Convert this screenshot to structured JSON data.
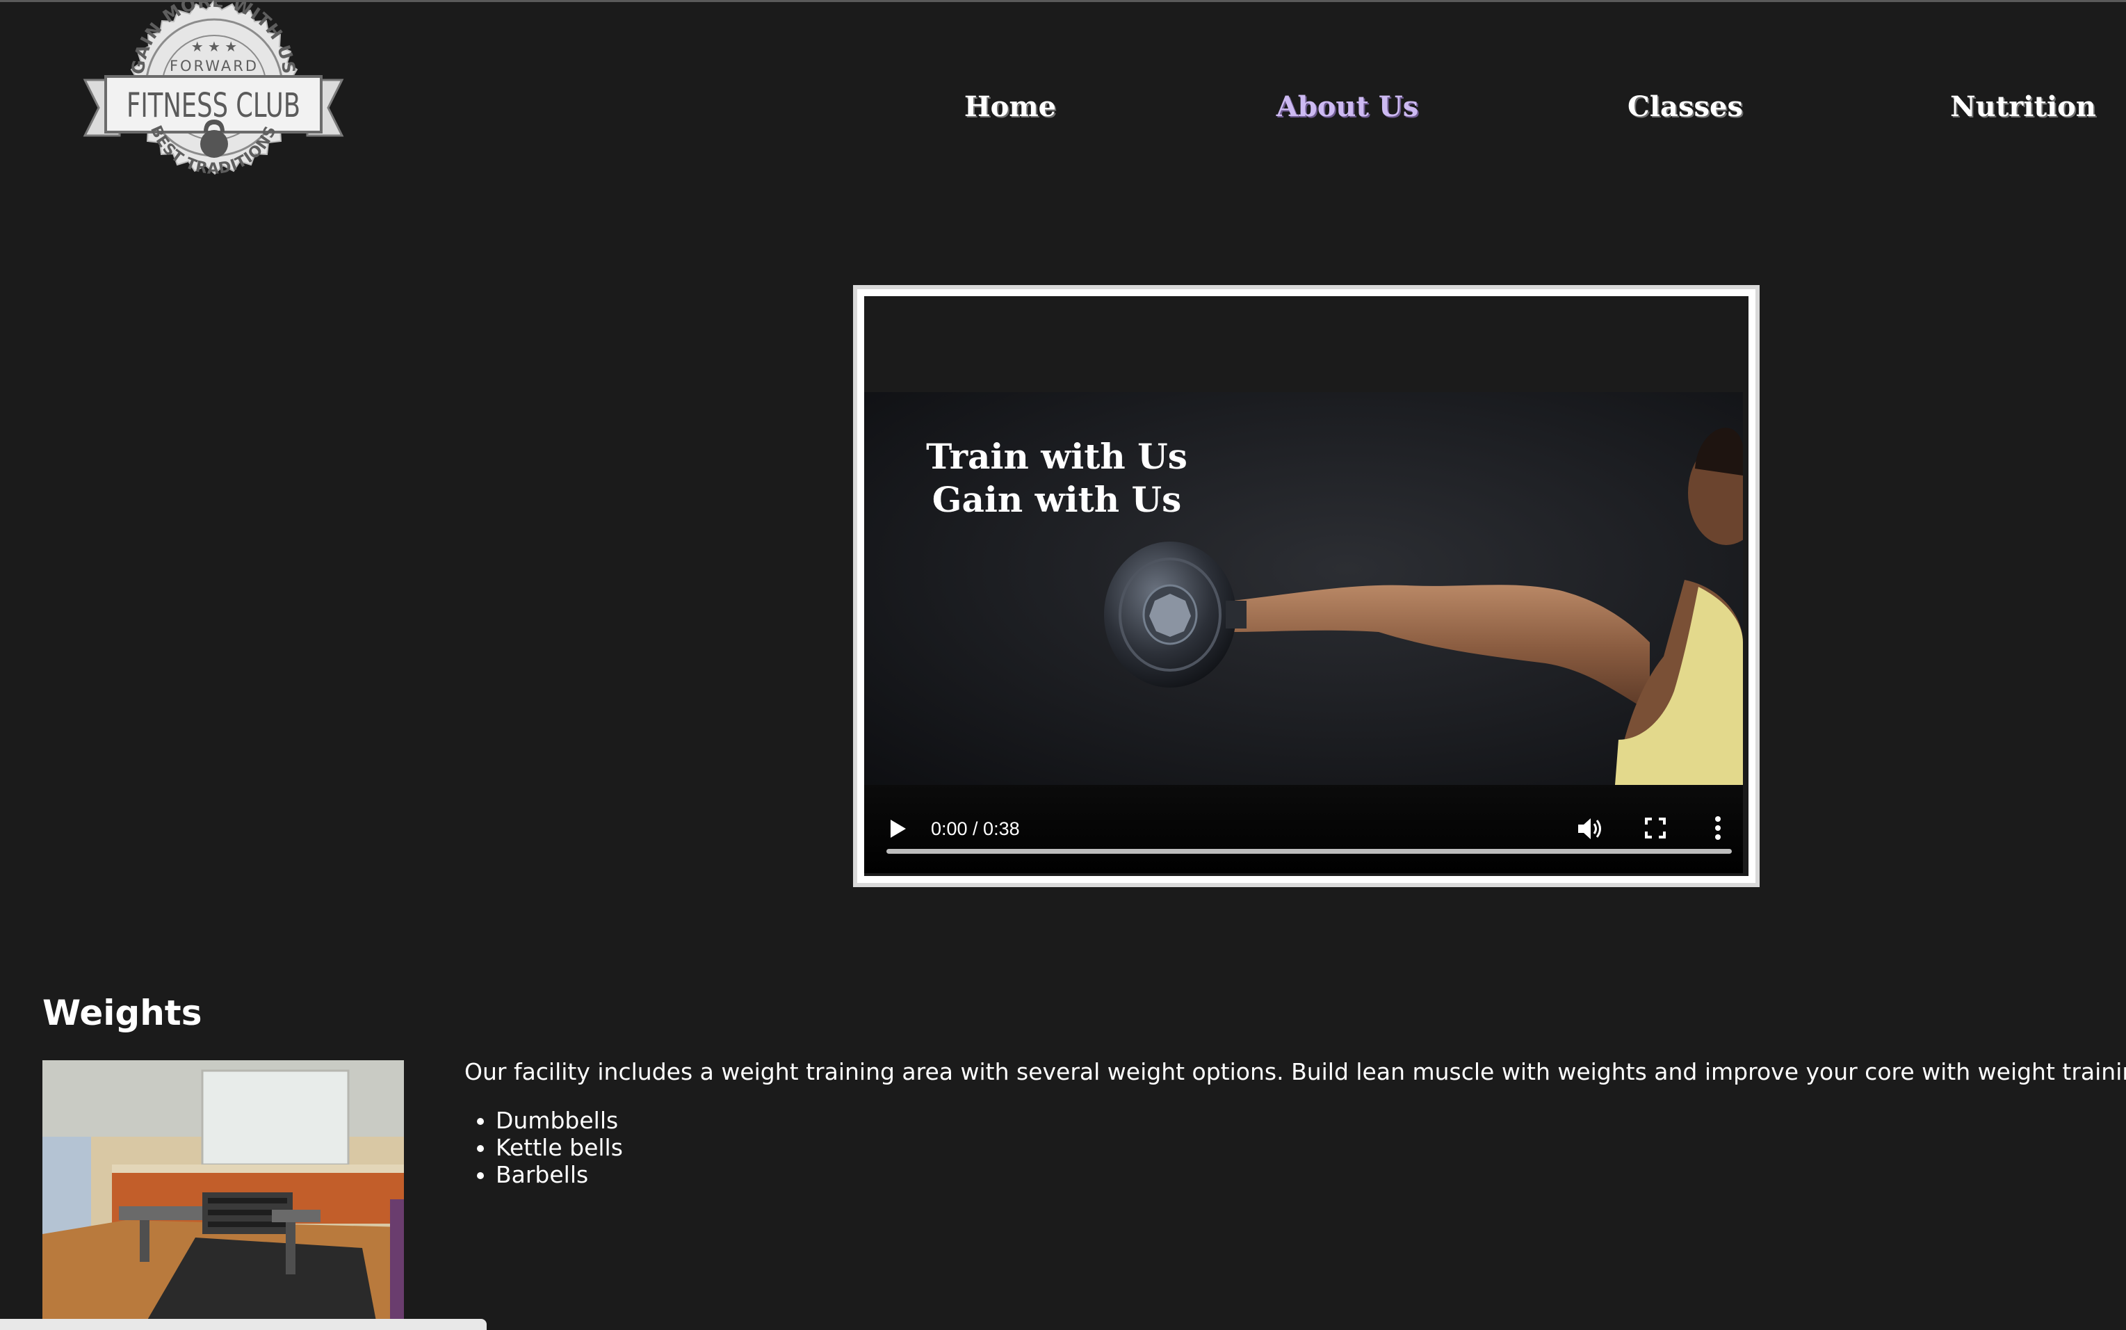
{
  "logo": {
    "arc_top": "GAIN MORE WITH US",
    "word_forward": "FORWARD",
    "name": "FITNESS CLUB",
    "arc_bottom": "BEST TRADITIONS",
    "stars": "★ ★ ★"
  },
  "nav": {
    "items": [
      {
        "label": "Home",
        "active": false
      },
      {
        "label": "About Us",
        "active": true
      },
      {
        "label": "Classes",
        "active": false
      },
      {
        "label": "Nutrition",
        "active": false
      }
    ]
  },
  "video": {
    "poster_line1": "Train with Us",
    "poster_line2": "Gain with Us",
    "current_time": "0:00",
    "duration": "0:38",
    "time_text": "0:00 / 0:38",
    "progress": 0,
    "icons": [
      "play-icon",
      "volume-icon",
      "fullscreen-icon",
      "more-options-icon"
    ]
  },
  "weights": {
    "title": "Weights",
    "description": "Our facility includes a weight training area with several weight options. Build lean muscle with weights and improve your core with weight training.",
    "items": [
      "Dumbbells",
      "Kettle bells",
      "Barbells"
    ]
  },
  "colors": {
    "background": "#1b1b1b",
    "nav_text": "#ffffff",
    "nav_active": "#cdbaf2",
    "video_border": "#d9d9d9"
  }
}
